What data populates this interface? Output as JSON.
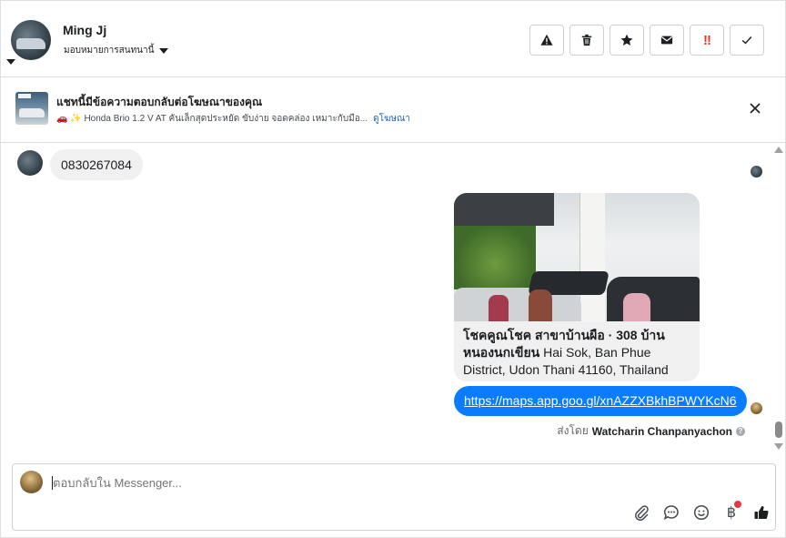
{
  "header": {
    "contact_name": "Ming Jj",
    "assign_label": "มอบหมายการสนทนานี้",
    "actions": [
      {
        "name": "spam-button",
        "icon": "warning-icon"
      },
      {
        "name": "delete-button",
        "icon": "trash-icon"
      },
      {
        "name": "star-button",
        "icon": "star-icon"
      },
      {
        "name": "mark-unread-button",
        "icon": "envelope-icon"
      },
      {
        "name": "follow-up-button",
        "icon": "double-exclamation-icon",
        "label": "!!"
      },
      {
        "name": "mark-done-button",
        "icon": "check-icon"
      }
    ]
  },
  "ad_banner": {
    "title": "แชทนี้มีข้อความตอบกลับต่อโฆษณาของคุณ",
    "description": "🚗 ✨ Honda Brio 1.2 V AT คันเล็กสุดประหยัด ขับง่าย จอดคล่อง เหมาะกับมือ...",
    "link_text": "ดูโฆษณา"
  },
  "messages": {
    "incoming_text": "0830267084",
    "location_card": {
      "title": "โชคคูณโชค สาขาบ้านผือ · 308 บ้าน หนองนกเขียน",
      "address": " Hai Sok, Ban Phue District, Udon Thani 41160, Thailand"
    },
    "outgoing_link": "https://maps.app.goo.gl/xnAZZXBkhBPWYKcN6",
    "sent_by_prefix": "ส่งโดย",
    "sent_by_name": "Watcharin Chanpanyachon",
    "help_glyph": "?"
  },
  "composer": {
    "placeholder": "ตอบกลับใน Messenger...",
    "baht_glyph": "฿"
  },
  "colors": {
    "accent_blue": "#0a7cff",
    "link_blue": "#1a64c9",
    "alert_red": "#e03a2e"
  }
}
